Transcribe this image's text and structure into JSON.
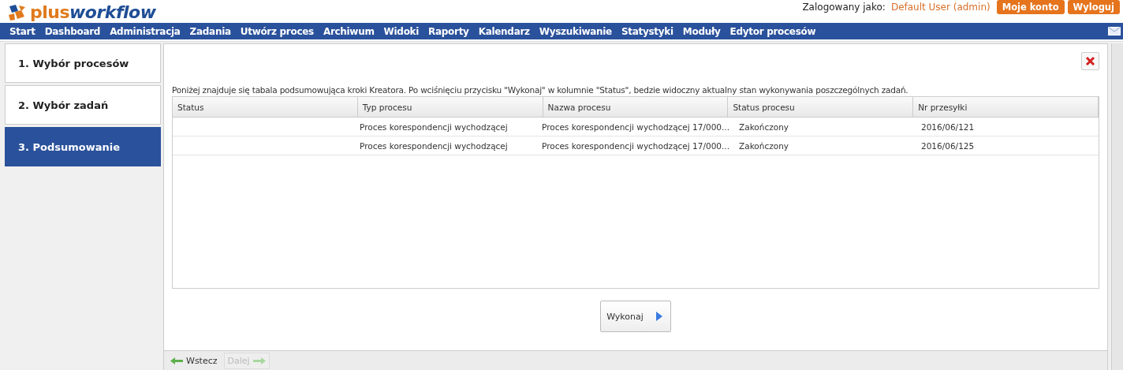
{
  "logo": {
    "parts": [
      "plus",
      "workflow"
    ]
  },
  "user": {
    "label": "Zalogowany jako:",
    "name": "Default User (admin)",
    "buttons": [
      "Moje konto",
      "Wyloguj"
    ]
  },
  "menu": {
    "items": [
      "Start",
      "Dashboard",
      "Administracja",
      "Zadania",
      "Utwórz proces",
      "Archiwum",
      "Widoki",
      "Raporty",
      "Kalendarz",
      "Wyszukiwanie",
      "Statystyki",
      "Moduły",
      "Edytor procesów"
    ]
  },
  "steps": [
    {
      "label": "1. Wybór procesów",
      "selected": false
    },
    {
      "label": "2. Wybór zadań",
      "selected": false
    },
    {
      "label": "3. Podsumowanie",
      "selected": true
    }
  ],
  "description": "Poniżej znajduje się tabala podsumowująca kroki Kreatora. Po wciśnięciu przycisku \"Wykonaj\" w kolumnie \"Status\", bedzie widoczny aktualny stan wykonywania poszczególnych zadań.",
  "table": {
    "columns": [
      "Status",
      "Typ procesu",
      "Nazwa procesu",
      "Status procesu",
      "Nr przesyłki"
    ],
    "rows": [
      [
        "",
        "Proces korespondencji wychodzącej",
        "Proces korespondencji wychodzącej 17/000...",
        "Zakończony",
        "2016/06/121"
      ],
      [
        "",
        "Proces korespondencji wychodzącej",
        "Proces korespondencji wychodzącej 17/000...",
        "Zakończony",
        "2016/06/125"
      ]
    ]
  },
  "execute_button": "Wykonaj",
  "footer": {
    "buttons": [
      {
        "label": "Wstecz",
        "disabled": false
      },
      {
        "label": "Dalej",
        "disabled": true
      }
    ]
  }
}
